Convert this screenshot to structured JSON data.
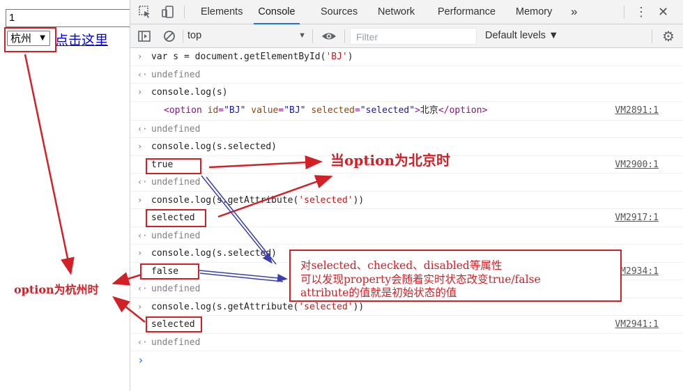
{
  "page": {
    "input_value": "1",
    "select_value": "杭州",
    "select_arrow": "▼",
    "link_text": "点击这里"
  },
  "devtools": {
    "tabs": [
      "Elements",
      "Console",
      "Sources",
      "Network",
      "Performance",
      "Memory"
    ],
    "active_tab": "Console",
    "more_tabs": "»",
    "kebab": "⋮",
    "close": "✕",
    "context": "top",
    "filter_placeholder": "Filter",
    "levels": "Default levels ▼",
    "accent_color": "#1a73e8"
  },
  "console": {
    "rows": [
      {
        "kind": "input",
        "text": "var s = document.getElementById('BJ')"
      },
      {
        "kind": "result",
        "text": "undefined"
      },
      {
        "kind": "input",
        "text": "console.log(s)"
      },
      {
        "kind": "log-html",
        "text": "<option id=\"BJ\" value=\"BJ\" selected=\"selected\">北京</option>",
        "src": "VM2891:1"
      },
      {
        "kind": "result",
        "text": "undefined"
      },
      {
        "kind": "input",
        "text": "console.log(s.selected)"
      },
      {
        "kind": "log",
        "text": "true",
        "src": "VM2900:1"
      },
      {
        "kind": "result",
        "text": "undefined"
      },
      {
        "kind": "input",
        "text": "console.log(s.getAttribute('selected'))"
      },
      {
        "kind": "log",
        "text": "selected",
        "src": "VM2917:1"
      },
      {
        "kind": "result",
        "text": "undefined"
      },
      {
        "kind": "input",
        "text": "console.log(s.selected)"
      },
      {
        "kind": "log",
        "text": "false",
        "src": "VM2934:1"
      },
      {
        "kind": "result",
        "text": "undefined"
      },
      {
        "kind": "input",
        "text": "console.log(s.getAttribute('selected'))"
      },
      {
        "kind": "log",
        "text": "selected",
        "src": "VM2941:1"
      },
      {
        "kind": "result",
        "text": "undefined"
      }
    ],
    "prompt": "›",
    "input_marker": "›",
    "result_marker": "‹·"
  },
  "annotations": {
    "beijing_label": "当option为北京时",
    "hangzhou_label": "option为杭州时",
    "note_lines": [
      "对selected、checked、disabled等属性",
      "可以发现property会随着实时状态改变true/false",
      "attribute的值就是初始状态的值"
    ],
    "red": "#d32027",
    "blue": "#3a3fb0"
  }
}
